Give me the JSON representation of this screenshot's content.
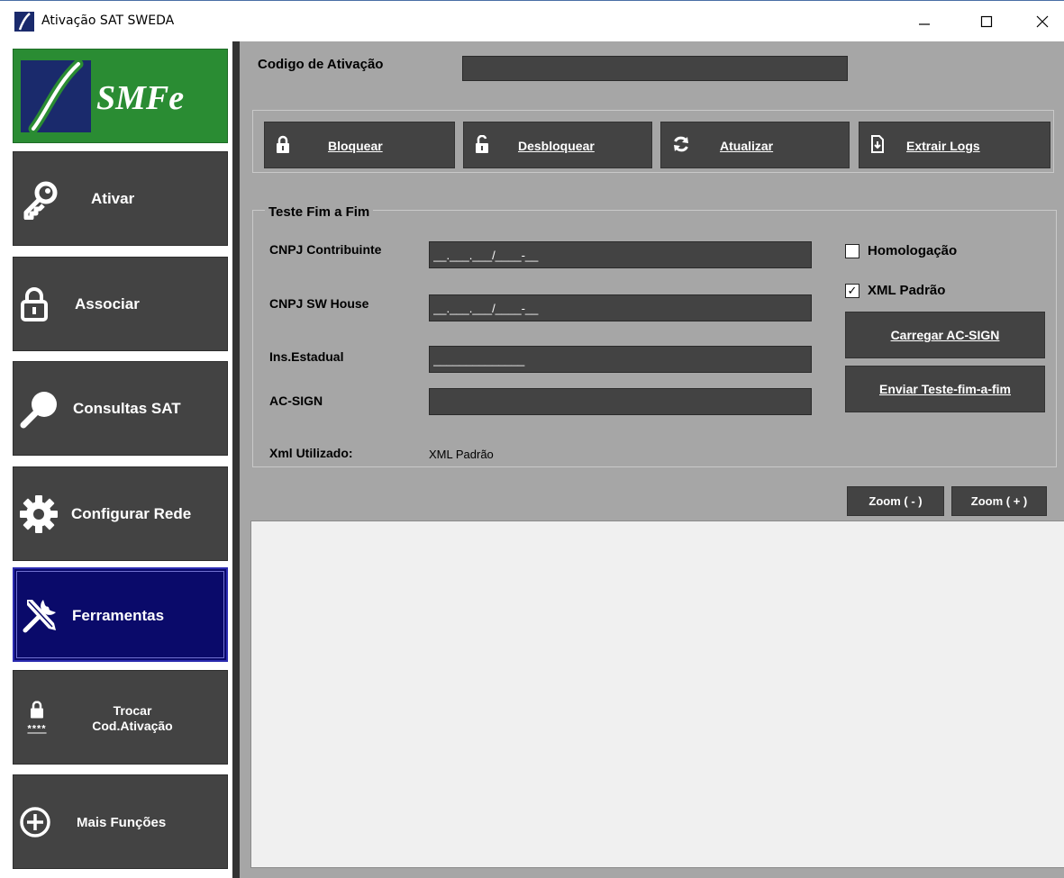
{
  "window": {
    "title": "Ativação SAT SWEDA",
    "minimize_icon": "minimize-icon",
    "maximize_icon": "maximize-icon",
    "close_icon": "close-icon"
  },
  "sidebar": {
    "logo_text": "SMFe",
    "items": [
      {
        "label": "Ativar",
        "icon": "key-icon"
      },
      {
        "label": "Associar",
        "icon": "lock-icon"
      },
      {
        "label": "Consultas SAT",
        "icon": "magnifier-icon"
      },
      {
        "label": "Configurar Rede",
        "icon": "gear-icon"
      },
      {
        "label": "Ferramentas",
        "icon": "tools-icon",
        "active": true
      },
      {
        "label_line1": "Trocar",
        "label_line2": "Cod.Ativação",
        "icon": "lock-password-icon",
        "icon_caption": "****"
      },
      {
        "label": "Mais Funções",
        "icon": "plus-circle-icon"
      }
    ]
  },
  "activation": {
    "label": "Codigo de Ativação",
    "value": ""
  },
  "toolbar": {
    "bloquear": {
      "label": "Bloquear",
      "icon": "lock-icon"
    },
    "desbloquear": {
      "label": "Desbloquear",
      "icon": "unlock-icon"
    },
    "atualizar": {
      "label": "Atualizar",
      "icon": "refresh-icon"
    },
    "extrair_logs": {
      "label": "Extrair Logs",
      "icon": "export-icon"
    }
  },
  "test": {
    "title": "Teste Fim a Fim",
    "cnpj_contribuinte": {
      "label": "CNPJ Contribuinte",
      "value": "__.___.___/____-__"
    },
    "cnpj_sw_house": {
      "label": "CNPJ SW House",
      "value": "__.___.___/____-__"
    },
    "ins_estadual": {
      "label": "Ins.Estadual",
      "value": "______________"
    },
    "ac_sign": {
      "label": "AC-SIGN",
      "value": ""
    },
    "xml_utilizado": {
      "label": "Xml Utilizado:",
      "value": "XML Padrão"
    },
    "homologacao": {
      "label": "Homologação",
      "checked": false
    },
    "xml_padrao": {
      "label": "XML Padrão",
      "checked": true,
      "mark": "✓"
    },
    "carregar_label": "Carregar AC-SIGN",
    "enviar_label": "Enviar Teste-fim-a-fim"
  },
  "zoom": {
    "out_label": "Zoom ( - )",
    "in_label": "Zoom ( + )"
  },
  "colors": {
    "button_dark": "#434343",
    "sidebar_active": "#0a0a6a",
    "logo_green": "#2a8c33",
    "panel_gray": "#a6a6a6",
    "output_bg": "#f0f0f0"
  }
}
